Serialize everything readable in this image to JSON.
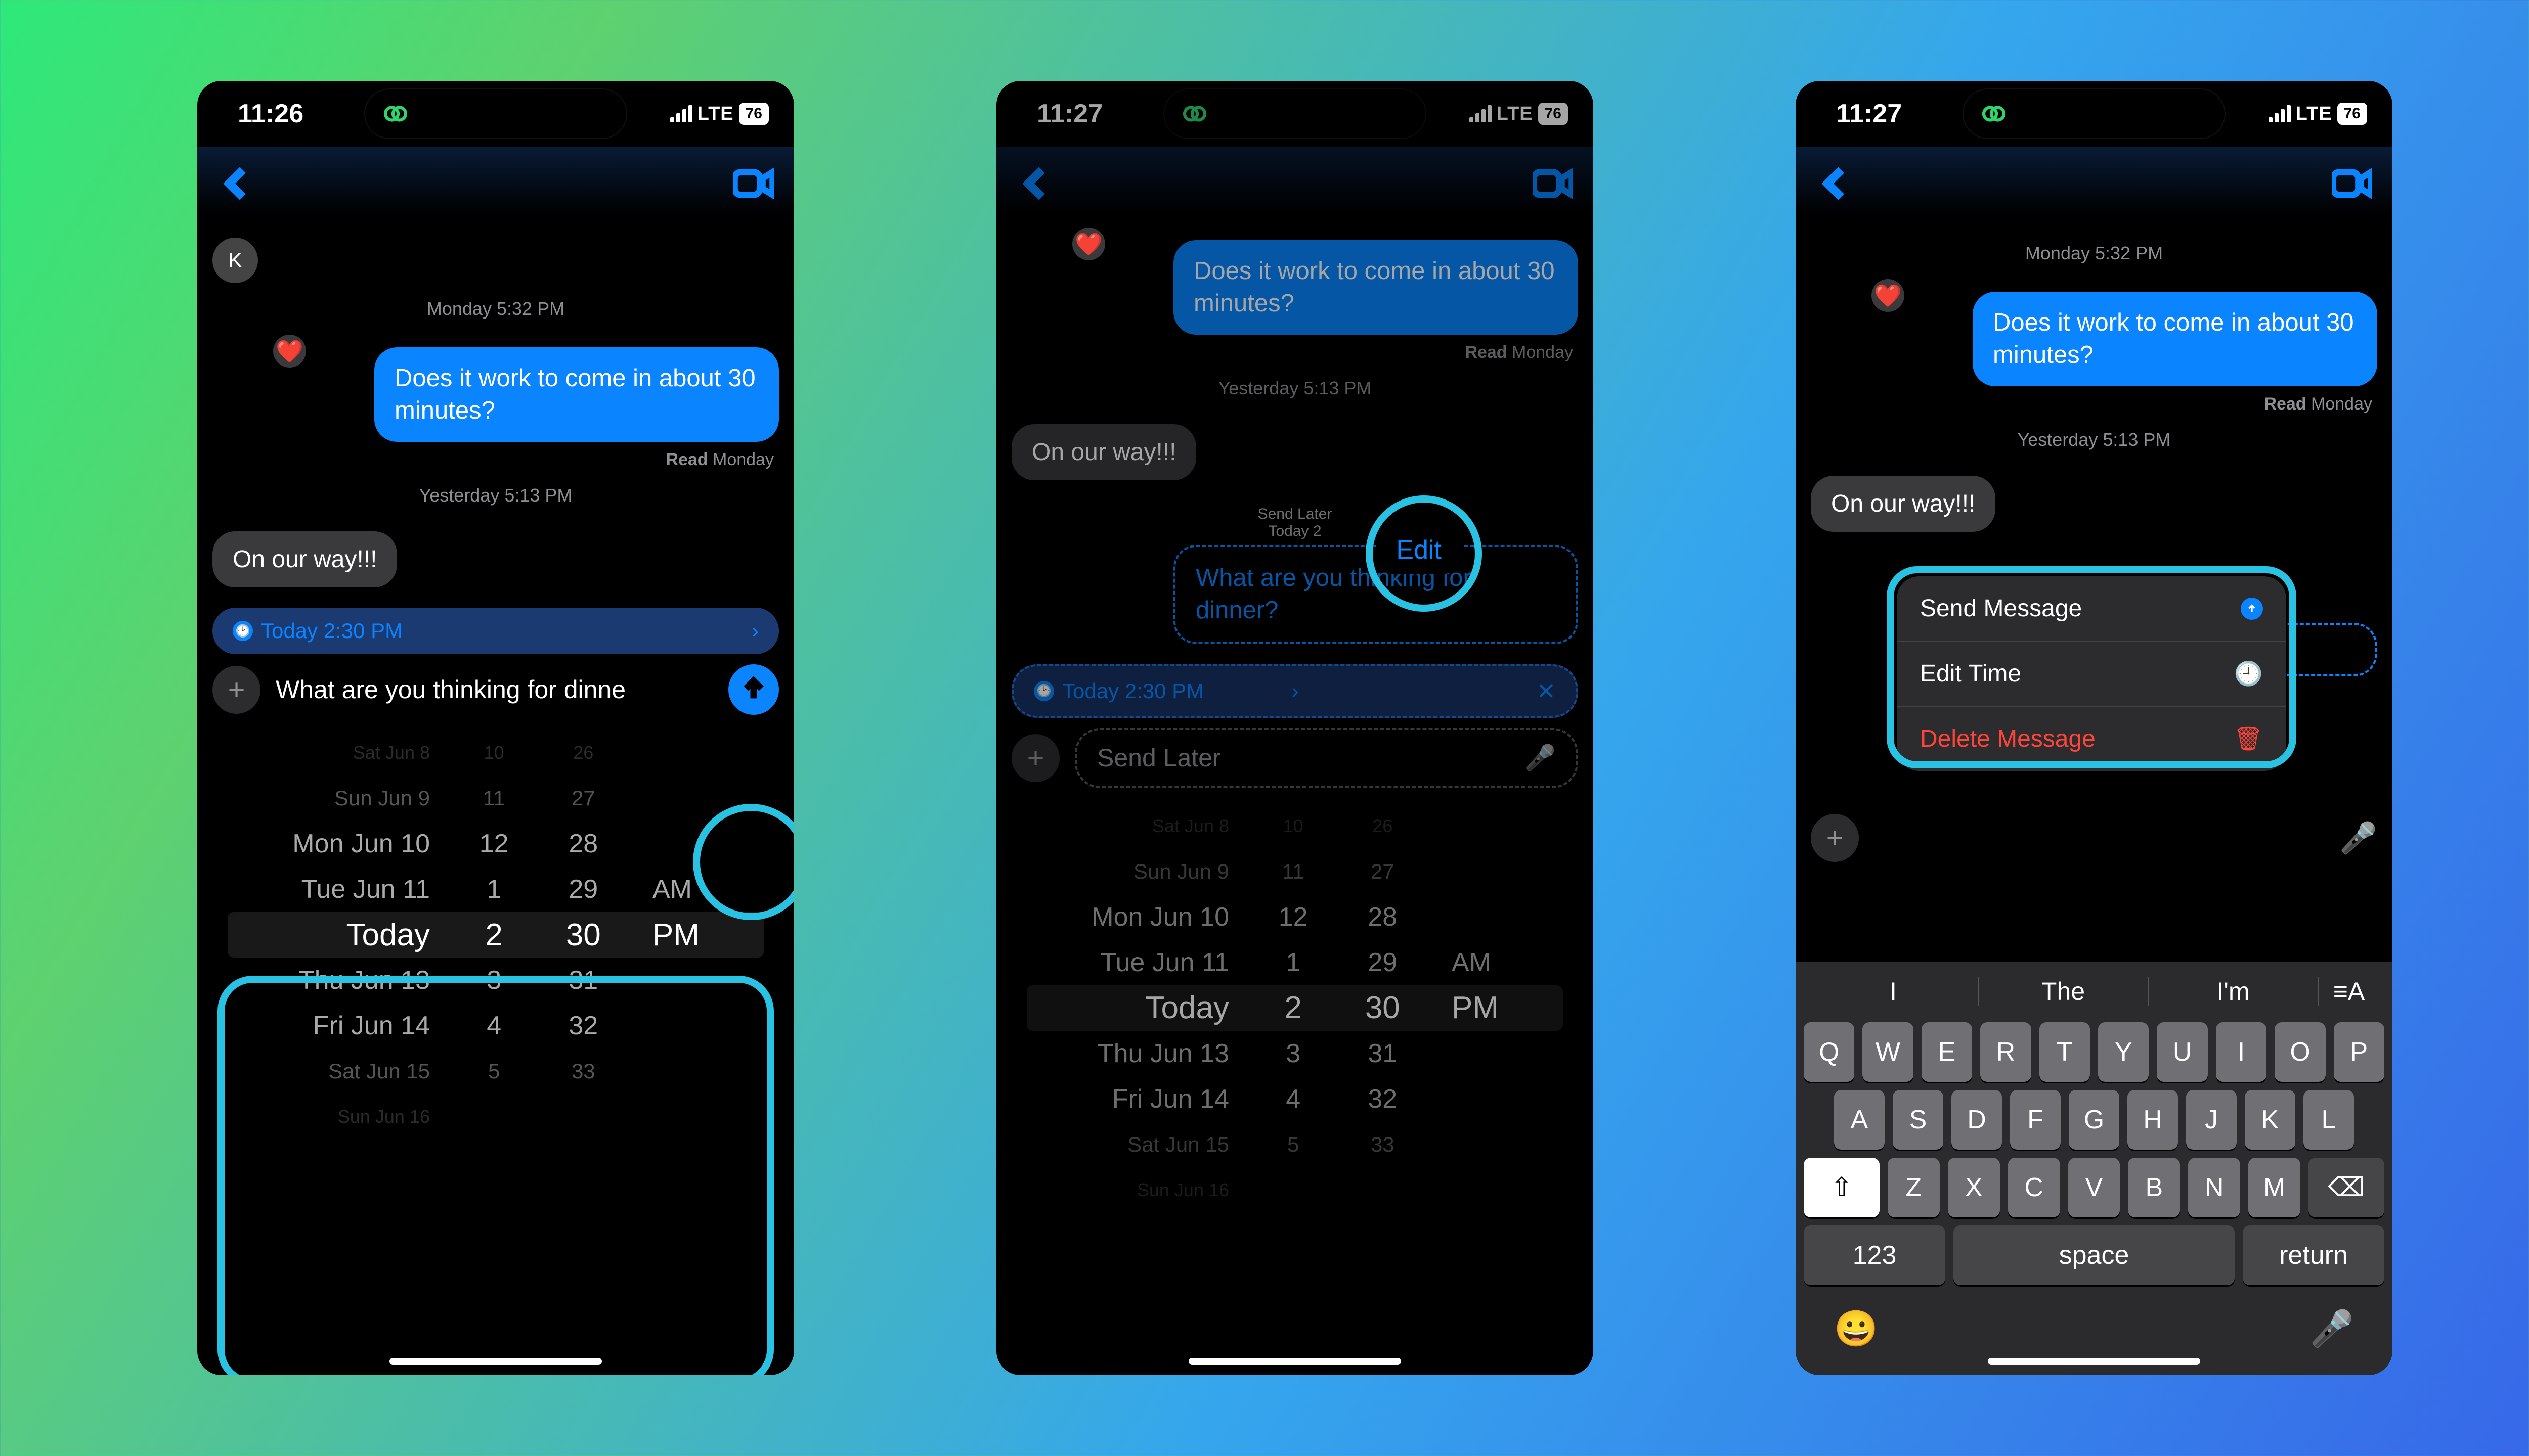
{
  "phones": [
    {
      "time": "11:26"
    },
    {
      "time": "11:27"
    },
    {
      "time": "11:27"
    }
  ],
  "statusbar": {
    "network": "LTE",
    "battery": "76"
  },
  "conversation": {
    "avatar_initial": "K",
    "ts1": "Monday 5:32 PM",
    "msg_blue": "Does it work to come in about 30 minutes?",
    "read_receipt_label": "Read",
    "read_receipt_when": "Monday",
    "ts2": "Yesterday 5:13 PM",
    "msg_gray": "On our way!!!",
    "scheduled_msg": "What are you thinking for dinner?",
    "scheduled_partial": "What are you thinking for dinne",
    "send_later_hint": "Send Later",
    "send_later_time_hint": "Today 2"
  },
  "schedule": {
    "label": "Today 2:30 PM"
  },
  "edit_badge": "Edit",
  "picker": {
    "rows": [
      {
        "d": "Sat Jun 8",
        "h": "10",
        "m": "26",
        "ap": "",
        "cls": "fade2"
      },
      {
        "d": "Sun Jun 9",
        "h": "11",
        "m": "27",
        "ap": "",
        "cls": "fade1"
      },
      {
        "d": "Mon Jun 10",
        "h": "12",
        "m": "28",
        "ap": "",
        "cls": ""
      },
      {
        "d": "Tue Jun 11",
        "h": "1",
        "m": "29",
        "ap": "AM",
        "cls": ""
      },
      {
        "d": "Today",
        "h": "2",
        "m": "30",
        "ap": "PM",
        "cls": "sel"
      },
      {
        "d": "Thu Jun 13",
        "h": "3",
        "m": "31",
        "ap": "",
        "cls": ""
      },
      {
        "d": "Fri Jun 14",
        "h": "4",
        "m": "32",
        "ap": "",
        "cls": ""
      },
      {
        "d": "Sat Jun 15",
        "h": "5",
        "m": "33",
        "ap": "",
        "cls": "fade1"
      },
      {
        "d": "Sun Jun 16",
        "h": "",
        "m": "",
        "ap": "",
        "cls": "fade2"
      }
    ]
  },
  "context_menu": {
    "send": "Send Message",
    "edit_time": "Edit Time",
    "delete": "Delete Message"
  },
  "keyboard": {
    "predictions": [
      "I",
      "The",
      "I'm"
    ],
    "row1": [
      "Q",
      "W",
      "E",
      "R",
      "T",
      "Y",
      "U",
      "I",
      "O",
      "P"
    ],
    "row2": [
      "A",
      "S",
      "D",
      "F",
      "G",
      "H",
      "J",
      "K",
      "L"
    ],
    "row3": [
      "Z",
      "X",
      "C",
      "V",
      "B",
      "N",
      "M"
    ],
    "num": "123",
    "space": "space",
    "return": "return"
  }
}
